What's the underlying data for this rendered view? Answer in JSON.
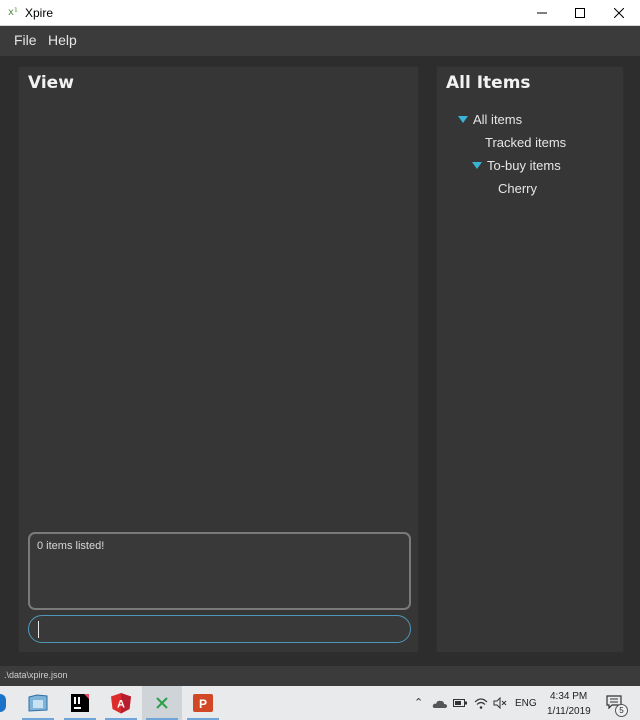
{
  "window": {
    "title": "Xpire",
    "app_icon_glyph": "x¹"
  },
  "menu": {
    "items": [
      "File",
      "Help"
    ]
  },
  "view_panel": {
    "title": "View",
    "result_text": "0 items listed!",
    "command_value": ""
  },
  "items_panel": {
    "title": "All Items",
    "tree": [
      {
        "label": "All items",
        "expanded": true,
        "depth": 0
      },
      {
        "label": "Tracked items",
        "expanded": false,
        "depth": 1
      },
      {
        "label": "To-buy items",
        "expanded": true,
        "depth": 1
      },
      {
        "label": "Cherry",
        "expanded": false,
        "depth": 2
      }
    ]
  },
  "status": {
    "path": ".\\data\\xpire.json"
  },
  "taskbar": {
    "apps": [
      "file-explorer-icon",
      "intellij-icon",
      "angular-icon",
      "xpire-icon",
      "powerpoint-icon"
    ],
    "lang": "ENG",
    "time": "4:34 PM",
    "date": "1/11/2019",
    "notifications": "5"
  },
  "colors": {
    "accent": "#37b4d6",
    "background": "#2b2b2b",
    "panel": "#363636"
  }
}
